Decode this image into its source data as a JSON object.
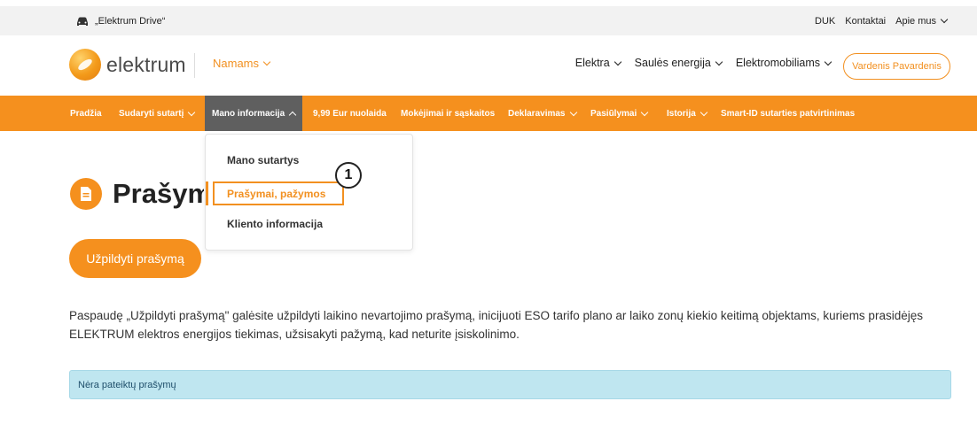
{
  "utility": {
    "brand": "„Elektrum Drive“",
    "links": {
      "faq": "DUK",
      "contacts": "Kontaktai",
      "about": "Apie mus"
    }
  },
  "header": {
    "logo_text": "elektrum",
    "segment": "Namams",
    "nav": {
      "electricity": "Elektra",
      "solar": "Saulės energija",
      "ev": "Elektromobiliams"
    },
    "user": "Vardenis Pavardenis"
  },
  "main_nav": {
    "home": "Pradžia",
    "sign": "Sudaryti sutartį",
    "my_info": "Mano informacija",
    "discount": "9,99 Eur nuolaida",
    "payments": "Mokėjimai ir sąskaitos",
    "declaring": "Deklaravimas",
    "offers": "Pasiūlymai",
    "history": "Istorija",
    "smart_id": "Smart-ID sutarties patvirtinimas"
  },
  "dropdown": {
    "contracts": "Mano sutartys",
    "requests": "Prašymai, pažymos",
    "client_info": "Kliento informacija"
  },
  "step_badge": "1",
  "page": {
    "title": "Prašymai, pažymos",
    "fill_button": "Užpildyti prašymą",
    "description": "Paspaudę „Užpildyti prašymą\" galėsite užpildyti laikino nevartojimo prašymą, inicijuoti ESO tarifo plano ar laiko zonų kiekio keitimą objektams, kuriems prasidėjęs ELEKTRUM elektros energijos tiekimas, užsisakyti pažymą, kad neturite įsiskolinimo.",
    "empty_notice": "Nėra pateiktų prašymų"
  },
  "colors": {
    "brand_orange": "#f5901e",
    "nav_active": "#5f5f5f",
    "alert_bg": "#bfe6f0"
  }
}
